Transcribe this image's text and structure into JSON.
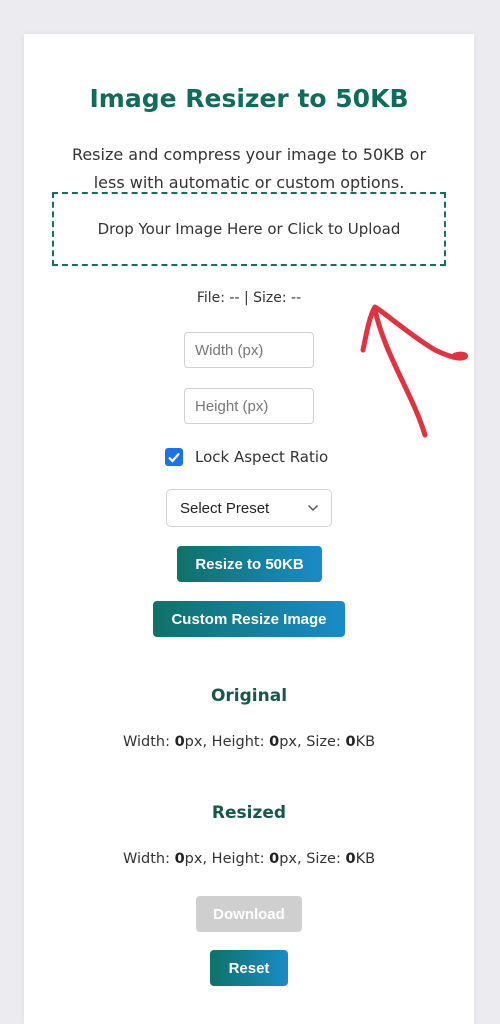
{
  "header": {
    "title": "Image Resizer to 50KB",
    "subtitle": "Resize and compress your image to 50KB or less with automatic or custom options."
  },
  "upload": {
    "label": "Drop Your Image Here or Click to Upload",
    "file_info": "File: -- | Size: --"
  },
  "inputs": {
    "width_placeholder": "Width (px)",
    "height_placeholder": "Height (px)"
  },
  "lock_aspect": {
    "label": "Lock Aspect Ratio",
    "checked": true
  },
  "preset": {
    "selected": "Select Preset"
  },
  "buttons": {
    "resize_50kb": "Resize to 50KB",
    "custom_resize": "Custom Resize Image",
    "download": "Download",
    "reset": "Reset"
  },
  "original": {
    "heading": "Original",
    "width_label": "Width: ",
    "width": "0",
    "height_label": "px, Height: ",
    "height": "0",
    "size_label": "px, Size: ",
    "size": "0",
    "size_unit": "KB"
  },
  "resized": {
    "heading": "Resized",
    "width_label": "Width: ",
    "width": "0",
    "height_label": "px, Height: ",
    "height": "0",
    "size_label": "px, Size: ",
    "size": "0",
    "size_unit": "KB"
  },
  "colors": {
    "accent": "#0f6b5a",
    "button_gradient_start": "#0f7268",
    "button_gradient_end": "#1a8bc8",
    "annotation": "#e0323f",
    "checkbox": "#1a73e8"
  }
}
